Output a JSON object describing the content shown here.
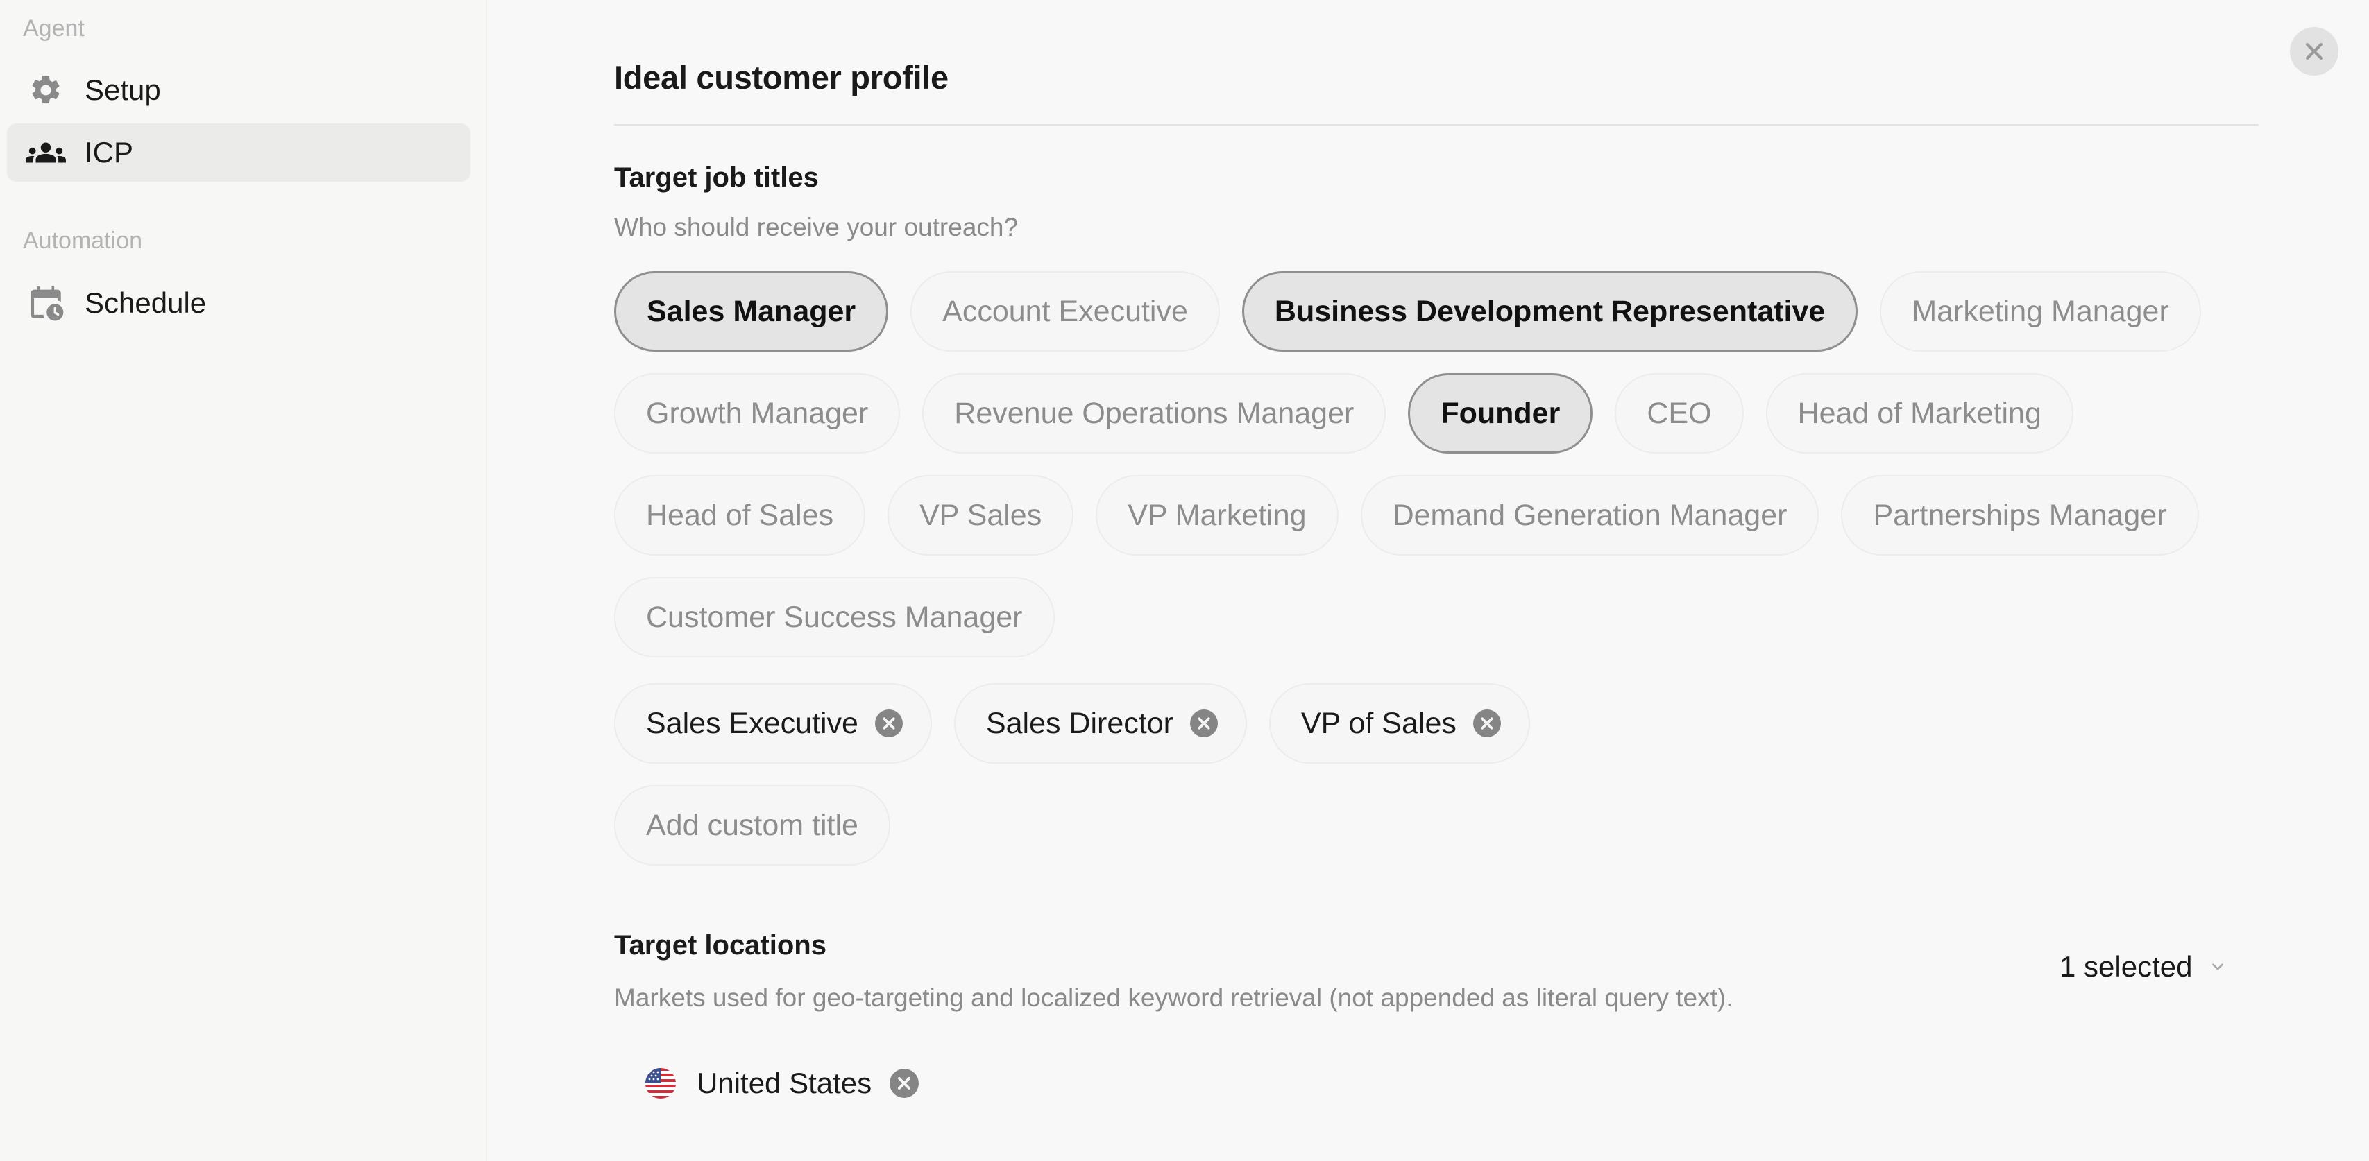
{
  "sidebar": {
    "sections": [
      {
        "title": "Agent",
        "items": [
          {
            "label": "Setup",
            "icon": "gear-icon"
          },
          {
            "label": "ICP",
            "icon": "users-icon",
            "active": true
          }
        ]
      },
      {
        "title": "Automation",
        "items": [
          {
            "label": "Schedule",
            "icon": "calendar-clock-icon"
          }
        ]
      }
    ]
  },
  "header": {
    "title": "Ideal customer profile",
    "close_icon": "close-icon"
  },
  "job_titles": {
    "title": "Target job titles",
    "subtitle": "Who should receive your outreach?",
    "rows": [
      [
        {
          "label": "Sales Manager",
          "selected": true
        },
        {
          "label": "Account Executive",
          "selected": false
        },
        {
          "label": "Business Development Representative",
          "selected": true
        },
        {
          "label": "Marketing Manager",
          "selected": false
        }
      ],
      [
        {
          "label": "Growth Manager",
          "selected": false
        },
        {
          "label": "Revenue Operations Manager",
          "selected": false
        },
        {
          "label": "Founder",
          "selected": true
        },
        {
          "label": "CEO",
          "selected": false
        },
        {
          "label": "Head of Marketing",
          "selected": false
        }
      ],
      [
        {
          "label": "Head of Sales",
          "selected": false
        },
        {
          "label": "VP Sales",
          "selected": false
        },
        {
          "label": "VP Marketing",
          "selected": false
        },
        {
          "label": "Demand Generation Manager",
          "selected": false
        },
        {
          "label": "Partnerships Manager",
          "selected": false
        }
      ],
      [
        {
          "label": "Customer Success Manager",
          "selected": false
        }
      ]
    ],
    "custom": [
      "Sales Executive",
      "Sales Director",
      "VP of Sales"
    ],
    "add_custom_placeholder": "Add custom title"
  },
  "locations": {
    "title": "Target locations",
    "subtitle": "Markets used for geo-targeting and localized keyword retrieval (not appended as literal query text).",
    "dropdown_value": "1 selected",
    "selected": [
      {
        "label": "United States",
        "flag": "us-flag-icon"
      }
    ]
  },
  "colors": {
    "background": "#f8f8f8",
    "sidebar": "#f7f7f6",
    "selected_chip": "#e4e4e4",
    "muted_text": "#8c8c8c"
  }
}
